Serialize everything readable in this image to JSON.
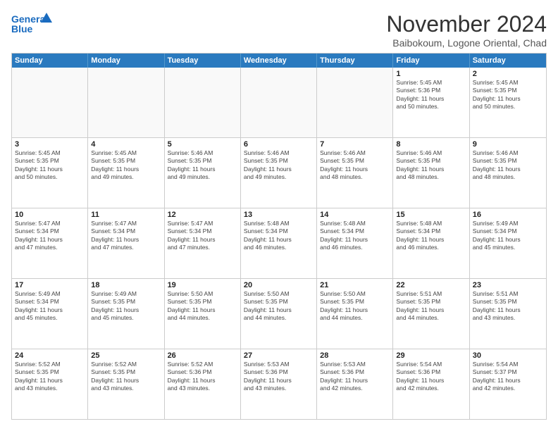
{
  "header": {
    "logo_line1": "General",
    "logo_line2": "Blue",
    "month_title": "November 2024",
    "location": "Baibokoum, Logone Oriental, Chad"
  },
  "day_headers": [
    "Sunday",
    "Monday",
    "Tuesday",
    "Wednesday",
    "Thursday",
    "Friday",
    "Saturday"
  ],
  "weeks": [
    [
      {
        "day": "",
        "info": ""
      },
      {
        "day": "",
        "info": ""
      },
      {
        "day": "",
        "info": ""
      },
      {
        "day": "",
        "info": ""
      },
      {
        "day": "",
        "info": ""
      },
      {
        "day": "1",
        "info": "Sunrise: 5:45 AM\nSunset: 5:36 PM\nDaylight: 11 hours\nand 50 minutes."
      },
      {
        "day": "2",
        "info": "Sunrise: 5:45 AM\nSunset: 5:35 PM\nDaylight: 11 hours\nand 50 minutes."
      }
    ],
    [
      {
        "day": "3",
        "info": "Sunrise: 5:45 AM\nSunset: 5:35 PM\nDaylight: 11 hours\nand 50 minutes."
      },
      {
        "day": "4",
        "info": "Sunrise: 5:45 AM\nSunset: 5:35 PM\nDaylight: 11 hours\nand 49 minutes."
      },
      {
        "day": "5",
        "info": "Sunrise: 5:46 AM\nSunset: 5:35 PM\nDaylight: 11 hours\nand 49 minutes."
      },
      {
        "day": "6",
        "info": "Sunrise: 5:46 AM\nSunset: 5:35 PM\nDaylight: 11 hours\nand 49 minutes."
      },
      {
        "day": "7",
        "info": "Sunrise: 5:46 AM\nSunset: 5:35 PM\nDaylight: 11 hours\nand 48 minutes."
      },
      {
        "day": "8",
        "info": "Sunrise: 5:46 AM\nSunset: 5:35 PM\nDaylight: 11 hours\nand 48 minutes."
      },
      {
        "day": "9",
        "info": "Sunrise: 5:46 AM\nSunset: 5:35 PM\nDaylight: 11 hours\nand 48 minutes."
      }
    ],
    [
      {
        "day": "10",
        "info": "Sunrise: 5:47 AM\nSunset: 5:34 PM\nDaylight: 11 hours\nand 47 minutes."
      },
      {
        "day": "11",
        "info": "Sunrise: 5:47 AM\nSunset: 5:34 PM\nDaylight: 11 hours\nand 47 minutes."
      },
      {
        "day": "12",
        "info": "Sunrise: 5:47 AM\nSunset: 5:34 PM\nDaylight: 11 hours\nand 47 minutes."
      },
      {
        "day": "13",
        "info": "Sunrise: 5:48 AM\nSunset: 5:34 PM\nDaylight: 11 hours\nand 46 minutes."
      },
      {
        "day": "14",
        "info": "Sunrise: 5:48 AM\nSunset: 5:34 PM\nDaylight: 11 hours\nand 46 minutes."
      },
      {
        "day": "15",
        "info": "Sunrise: 5:48 AM\nSunset: 5:34 PM\nDaylight: 11 hours\nand 46 minutes."
      },
      {
        "day": "16",
        "info": "Sunrise: 5:49 AM\nSunset: 5:34 PM\nDaylight: 11 hours\nand 45 minutes."
      }
    ],
    [
      {
        "day": "17",
        "info": "Sunrise: 5:49 AM\nSunset: 5:34 PM\nDaylight: 11 hours\nand 45 minutes."
      },
      {
        "day": "18",
        "info": "Sunrise: 5:49 AM\nSunset: 5:35 PM\nDaylight: 11 hours\nand 45 minutes."
      },
      {
        "day": "19",
        "info": "Sunrise: 5:50 AM\nSunset: 5:35 PM\nDaylight: 11 hours\nand 44 minutes."
      },
      {
        "day": "20",
        "info": "Sunrise: 5:50 AM\nSunset: 5:35 PM\nDaylight: 11 hours\nand 44 minutes."
      },
      {
        "day": "21",
        "info": "Sunrise: 5:50 AM\nSunset: 5:35 PM\nDaylight: 11 hours\nand 44 minutes."
      },
      {
        "day": "22",
        "info": "Sunrise: 5:51 AM\nSunset: 5:35 PM\nDaylight: 11 hours\nand 44 minutes."
      },
      {
        "day": "23",
        "info": "Sunrise: 5:51 AM\nSunset: 5:35 PM\nDaylight: 11 hours\nand 43 minutes."
      }
    ],
    [
      {
        "day": "24",
        "info": "Sunrise: 5:52 AM\nSunset: 5:35 PM\nDaylight: 11 hours\nand 43 minutes."
      },
      {
        "day": "25",
        "info": "Sunrise: 5:52 AM\nSunset: 5:35 PM\nDaylight: 11 hours\nand 43 minutes."
      },
      {
        "day": "26",
        "info": "Sunrise: 5:52 AM\nSunset: 5:36 PM\nDaylight: 11 hours\nand 43 minutes."
      },
      {
        "day": "27",
        "info": "Sunrise: 5:53 AM\nSunset: 5:36 PM\nDaylight: 11 hours\nand 43 minutes."
      },
      {
        "day": "28",
        "info": "Sunrise: 5:53 AM\nSunset: 5:36 PM\nDaylight: 11 hours\nand 42 minutes."
      },
      {
        "day": "29",
        "info": "Sunrise: 5:54 AM\nSunset: 5:36 PM\nDaylight: 11 hours\nand 42 minutes."
      },
      {
        "day": "30",
        "info": "Sunrise: 5:54 AM\nSunset: 5:37 PM\nDaylight: 11 hours\nand 42 minutes."
      }
    ]
  ]
}
